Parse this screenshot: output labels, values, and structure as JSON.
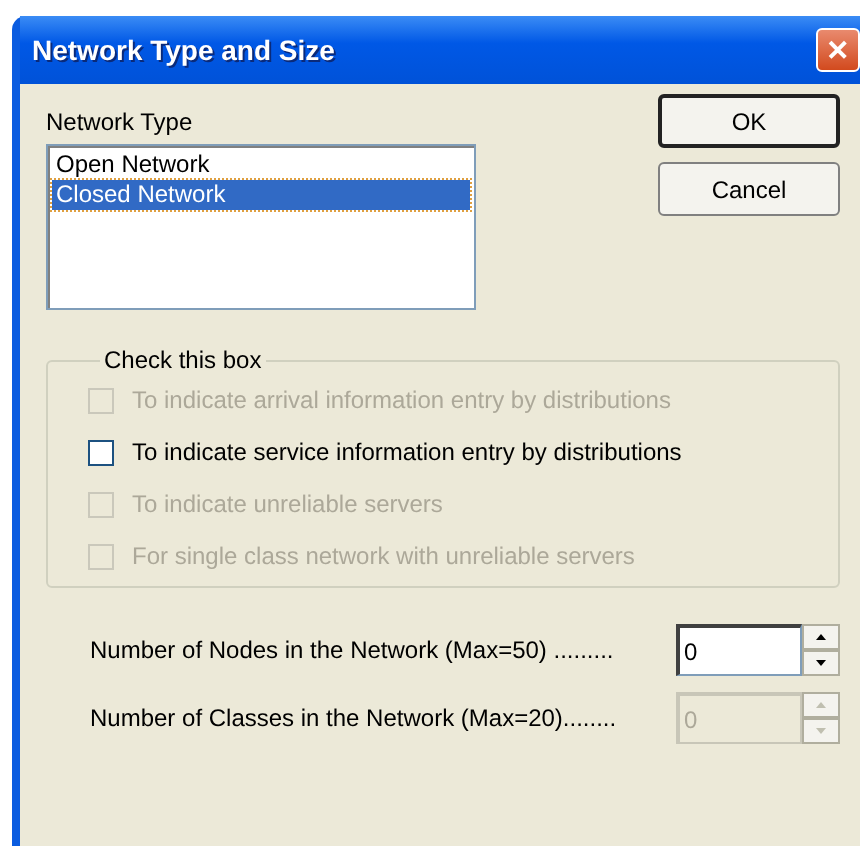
{
  "window": {
    "title": "Network Type and Size",
    "close": "✕"
  },
  "network_type": {
    "label": "Network Type",
    "items": [
      {
        "label": "Open Network",
        "selected": false
      },
      {
        "label": "Closed Network",
        "selected": true
      }
    ]
  },
  "buttons": [
    {
      "label": "OK",
      "default": true
    },
    {
      "label": "Cancel",
      "default": false
    }
  ],
  "check_group": {
    "title": "Check this box",
    "items": [
      {
        "label": "To indicate arrival information entry by distributions",
        "checked": false,
        "disabled": true
      },
      {
        "label": "To indicate service information entry by distributions",
        "checked": false,
        "disabled": false
      },
      {
        "label": "To indicate unreliable servers",
        "checked": false,
        "disabled": true
      },
      {
        "label": "For single class network with unreliable servers",
        "checked": false,
        "disabled": true
      }
    ]
  },
  "spinners": [
    {
      "label": "Number of Nodes in the Network (Max=50) .........",
      "value": "0",
      "disabled": false
    },
    {
      "label": "Number of Classes in the Network (Max=20)........",
      "value": "0",
      "disabled": true
    }
  ]
}
